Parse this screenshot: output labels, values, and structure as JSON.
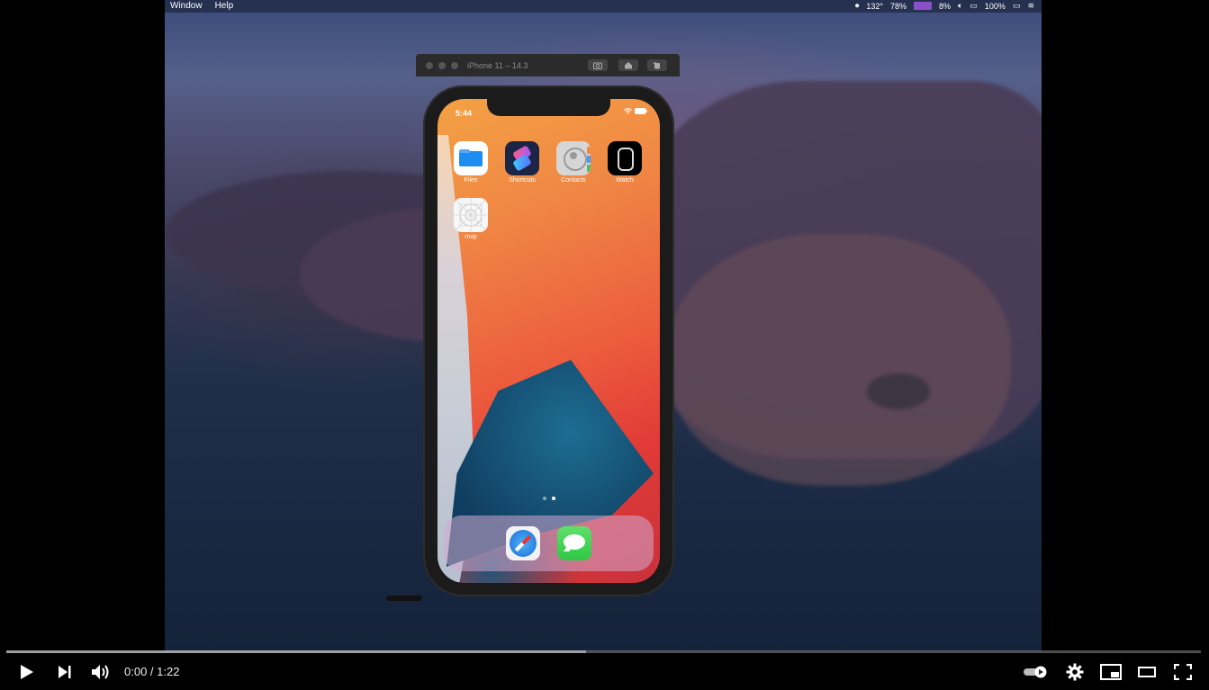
{
  "menubar": {
    "items": [
      "Window",
      "Help"
    ],
    "status": {
      "temp": "132°",
      "cpu": "78%",
      "mem": "8%",
      "battery": "100%"
    }
  },
  "simulator": {
    "title": "iPhone 11 – 14.3"
  },
  "phone": {
    "time": "5:44",
    "apps": [
      {
        "label": "Files",
        "icon": "files-icon"
      },
      {
        "label": "Shortcuts",
        "icon": "shortcuts-icon"
      },
      {
        "label": "Contacts",
        "icon": "contacts-icon"
      },
      {
        "label": "Watch",
        "icon": "watch-icon"
      },
      {
        "label": "mvp",
        "icon": "mvp-app-icon"
      }
    ],
    "dock": [
      {
        "icon": "safari-icon"
      },
      {
        "icon": "messages-icon"
      }
    ]
  },
  "player": {
    "timecode": "0:00 / 1:22",
    "loaded_fraction": 0.485,
    "played_fraction": 0
  }
}
